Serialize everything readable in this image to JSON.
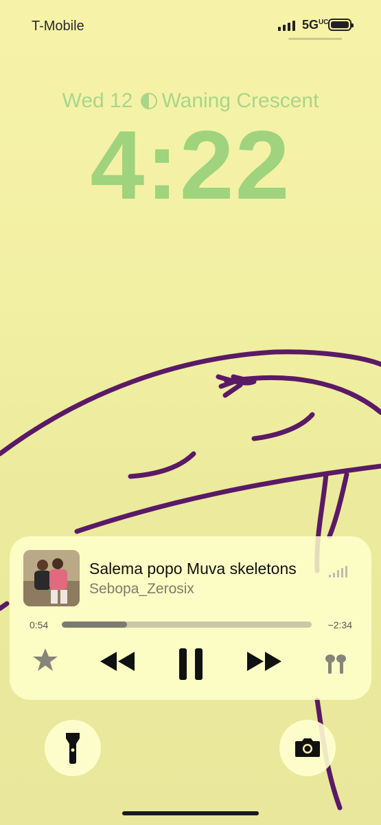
{
  "status": {
    "carrier": "T-Mobile",
    "network": "5G",
    "network_suffix": "UC"
  },
  "lock": {
    "date": "Wed 12",
    "moon_phase": "Waning Crescent",
    "time": "4:22"
  },
  "now_playing": {
    "title": "Salema popo Muva skeletons",
    "artist": "Sebopa_Zerosix",
    "elapsed": "0:54",
    "remaining": "−2:34",
    "progress_fraction": 0.26
  },
  "icons": [
    "star-icon",
    "rewind-icon",
    "pause-icon",
    "fast-forward-icon",
    "airpods-icon",
    "flashlight-icon",
    "camera-icon"
  ],
  "colors": {
    "clock": "#9fd37e",
    "background": "#f4f2a6",
    "drawing": "#5a1a66"
  }
}
